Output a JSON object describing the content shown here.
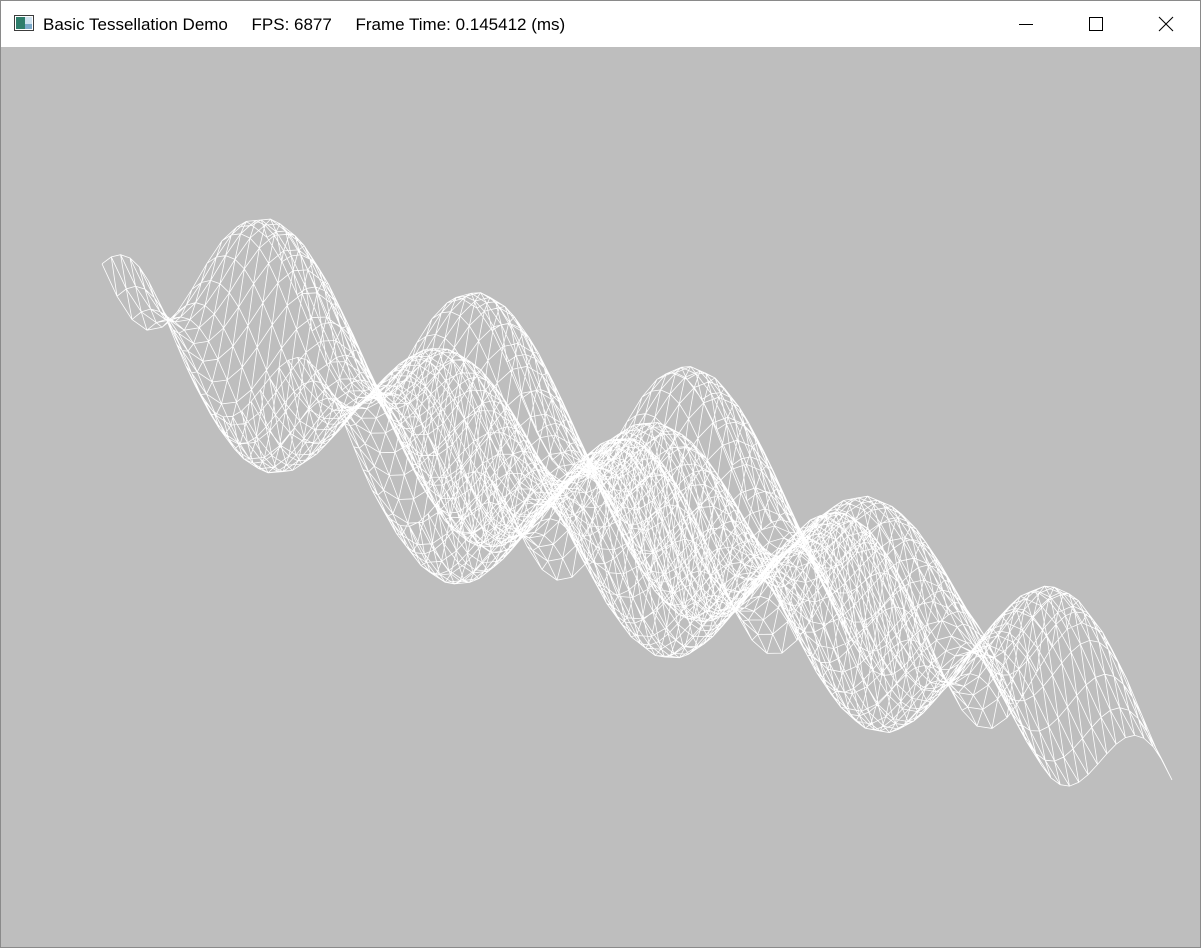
{
  "window": {
    "app_name": "Basic Tessellation Demo",
    "fps_text": "FPS: 6877",
    "frame_time_text": "Frame Time: 0.145412 (ms)"
  },
  "controls": {
    "minimize_icon": "minimize-icon",
    "maximize_icon": "maximize-icon",
    "close_icon": "close-icon"
  },
  "viewport": {
    "background_color": "#bebebe",
    "mesh_color": "#ffffff",
    "content": "wireframe-tessellated-wave-surface"
  }
}
